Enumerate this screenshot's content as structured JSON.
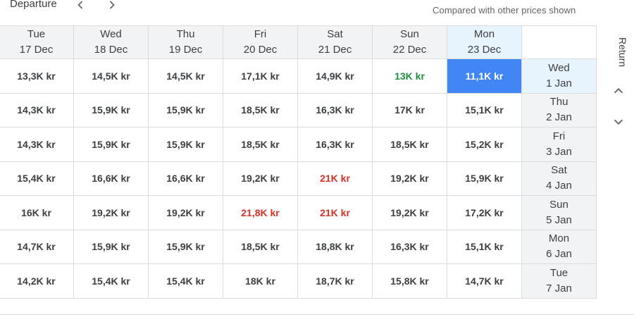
{
  "topbar": {
    "departure_label": "Departure",
    "compare_note": "Compared with other prices shown"
  },
  "side": {
    "return_label": "Return"
  },
  "icons": {
    "prev": "chevron-left-icon",
    "next": "chevron-right-icon",
    "up": "chevron-up-icon",
    "down": "chevron-down-icon"
  },
  "colors": {
    "selected": "#4285f4",
    "low": "#1e8e3e",
    "high": "#d93025",
    "header_bg": "#f1f3f4",
    "selected_header_bg": "#e8f4fd"
  },
  "departures": [
    {
      "day": "Tue",
      "date": "17 Dec"
    },
    {
      "day": "Wed",
      "date": "18 Dec"
    },
    {
      "day": "Thu",
      "date": "19 Dec"
    },
    {
      "day": "Fri",
      "date": "20 Dec"
    },
    {
      "day": "Sat",
      "date": "21 Dec"
    },
    {
      "day": "Sun",
      "date": "22 Dec"
    },
    {
      "day": "Mon",
      "date": "23 Dec"
    }
  ],
  "returns": [
    {
      "day": "Wed",
      "date": "1 Jan"
    },
    {
      "day": "Thu",
      "date": "2 Jan"
    },
    {
      "day": "Fri",
      "date": "3 Jan"
    },
    {
      "day": "Sat",
      "date": "4 Jan"
    },
    {
      "day": "Sun",
      "date": "5 Jan"
    },
    {
      "day": "Mon",
      "date": "6 Jan"
    },
    {
      "day": "Tue",
      "date": "7 Jan"
    }
  ],
  "selected": {
    "departure": 6,
    "return": 0
  },
  "prices": [
    [
      "13,3K kr",
      "14,5K kr",
      "14,5K kr",
      "17,1K kr",
      "14,9K kr",
      "13K kr",
      "11,1K kr"
    ],
    [
      "14,3K kr",
      "15,9K kr",
      "15,9K kr",
      "18,5K kr",
      "16,3K kr",
      "17K kr",
      "15,1K kr"
    ],
    [
      "14,3K kr",
      "15,9K kr",
      "15,9K kr",
      "18,5K kr",
      "16,3K kr",
      "18,5K kr",
      "15,2K kr"
    ],
    [
      "15,4K kr",
      "16,6K kr",
      "16,6K kr",
      "19,2K kr",
      "21K kr",
      "19,2K kr",
      "15,9K kr"
    ],
    [
      "16K kr",
      "19,2K kr",
      "19,2K kr",
      "21,8K kr",
      "21K kr",
      "19,2K kr",
      "17,2K kr"
    ],
    [
      "14,7K kr",
      "15,9K kr",
      "15,9K kr",
      "18,5K kr",
      "18,8K kr",
      "16,3K kr",
      "15,1K kr"
    ],
    [
      "14,2K kr",
      "15,4K kr",
      "15,4K kr",
      "18K kr",
      "18,7K kr",
      "15,8K kr",
      "14,7K kr"
    ]
  ],
  "price_status": [
    [
      "normal",
      "normal",
      "normal",
      "normal",
      "normal",
      "low",
      "selected"
    ],
    [
      "normal",
      "normal",
      "normal",
      "normal",
      "normal",
      "normal",
      "normal"
    ],
    [
      "normal",
      "normal",
      "normal",
      "normal",
      "normal",
      "normal",
      "normal"
    ],
    [
      "normal",
      "normal",
      "normal",
      "normal",
      "high",
      "normal",
      "normal"
    ],
    [
      "normal",
      "normal",
      "normal",
      "high",
      "high",
      "normal",
      "normal"
    ],
    [
      "normal",
      "normal",
      "normal",
      "normal",
      "normal",
      "normal",
      "normal"
    ],
    [
      "normal",
      "normal",
      "normal",
      "normal",
      "normal",
      "normal",
      "normal"
    ]
  ]
}
